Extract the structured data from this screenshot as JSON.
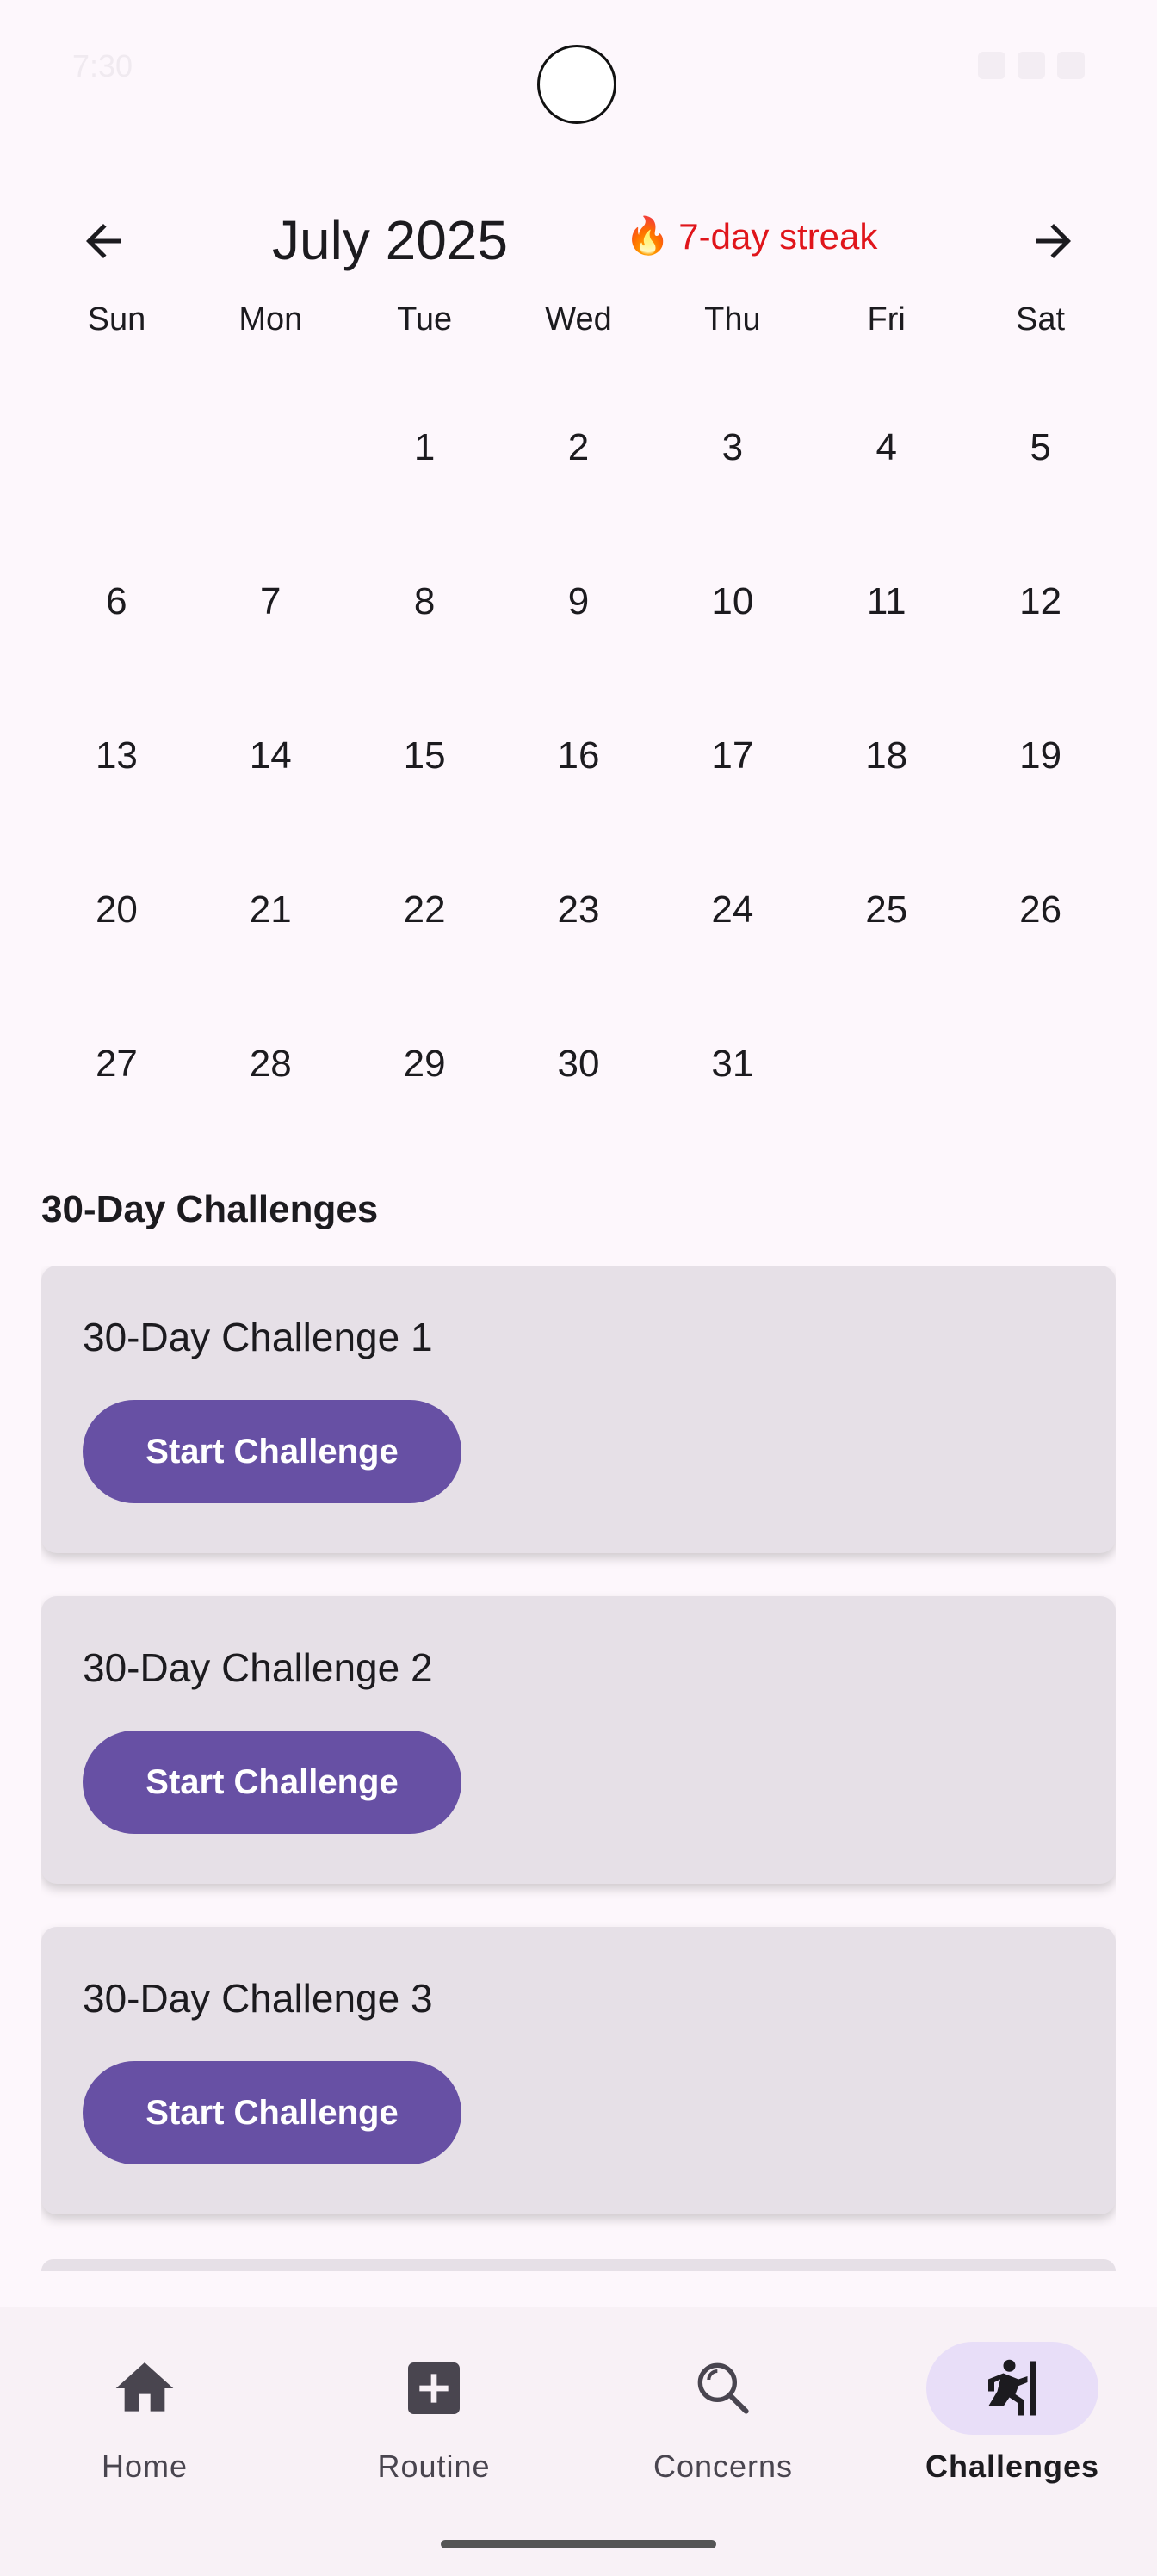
{
  "status_bar": {
    "time": "7:30"
  },
  "calendar": {
    "month_title": "July 2025",
    "streak_text": "7-day streak",
    "streak_icon": "fire-icon",
    "prev_icon": "arrow-left-icon",
    "next_icon": "arrow-right-icon",
    "weekdays": [
      "Sun",
      "Mon",
      "Tue",
      "Wed",
      "Thu",
      "Fri",
      "Sat"
    ],
    "leading_blank_days": 2,
    "days": [
      "1",
      "2",
      "3",
      "4",
      "5",
      "6",
      "7",
      "8",
      "9",
      "10",
      "11",
      "12",
      "13",
      "14",
      "15",
      "16",
      "17",
      "18",
      "19",
      "20",
      "21",
      "22",
      "23",
      "24",
      "25",
      "26",
      "27",
      "28",
      "29",
      "30",
      "31"
    ]
  },
  "challenges": {
    "section_title": "30-Day Challenges",
    "items": [
      {
        "title": "30-Day Challenge 1",
        "button": "Start Challenge"
      },
      {
        "title": "30-Day Challenge 2",
        "button": "Start Challenge"
      },
      {
        "title": "30-Day Challenge 3",
        "button": "Start Challenge"
      }
    ]
  },
  "bottom_nav": {
    "items": [
      {
        "label": "Home",
        "icon": "home-icon",
        "active": false
      },
      {
        "label": "Routine",
        "icon": "add-box-icon",
        "active": false
      },
      {
        "label": "Concerns",
        "icon": "search-icon",
        "active": false
      },
      {
        "label": "Challenges",
        "icon": "challenge-person-icon",
        "active": true
      }
    ]
  },
  "colors": {
    "accent": "#6750a4",
    "streak": "#e0151b",
    "active_nav_bg": "#e8def8",
    "card_bg": "#e6e0e7"
  }
}
